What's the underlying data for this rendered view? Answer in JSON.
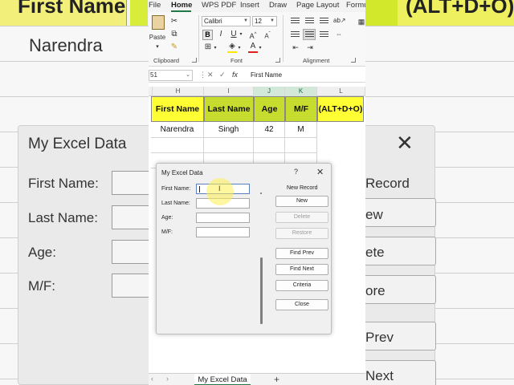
{
  "background": {
    "header_text": "First Name",
    "right_header_text": "(ALT+D+O)",
    "name_text": "Narendra",
    "panel": {
      "title": "My Excel Data",
      "labels": [
        "First Name:",
        "Last Name:",
        "Age:",
        "M/F:"
      ],
      "right_text": [
        "Record",
        "ew",
        "ete",
        "ore",
        "Prev",
        "Next"
      ]
    }
  },
  "menu": {
    "tabs": [
      "File",
      "Home",
      "WPS PDF",
      "Insert",
      "Draw",
      "Page Layout",
      "Formu"
    ],
    "active": "Home"
  },
  "ribbon": {
    "clipboard": {
      "paste_label": "Paste",
      "group_label": "Clipboard"
    },
    "font": {
      "font_name": "Calibri",
      "font_size": "12",
      "group_label": "Font",
      "bold": "B",
      "italic": "I",
      "underline": "U"
    },
    "alignment": {
      "group_label": "Alignment"
    }
  },
  "formula_bar": {
    "name_box": "51",
    "fx": "fx",
    "content": "First Name"
  },
  "columns": [
    "H",
    "I",
    "J",
    "K",
    "L"
  ],
  "sheet": {
    "headers": [
      "First Name",
      "Last Name",
      "Age",
      "M/F",
      "(ALT+D+O)"
    ],
    "row1": [
      "Narendra",
      "Singh",
      "42",
      "M"
    ]
  },
  "sheet_tabs": {
    "active": "My Excel Data",
    "add": "+"
  },
  "dialog": {
    "title": "My Excel Data",
    "help": "?",
    "close": "✕",
    "fields": [
      {
        "label": "First Name:",
        "value": ""
      },
      {
        "label": "Last Name:",
        "value": ""
      },
      {
        "label": "Age:",
        "value": ""
      },
      {
        "label": "M/F:",
        "value": ""
      }
    ],
    "record_status": "New Record",
    "buttons": [
      {
        "label": "New",
        "enabled": true
      },
      {
        "label": "Delete",
        "enabled": false
      },
      {
        "label": "Restore",
        "enabled": false
      },
      {
        "label": "Find Prev",
        "enabled": true
      },
      {
        "label": "Find Next",
        "enabled": true
      },
      {
        "label": "Criteria",
        "enabled": true
      },
      {
        "label": "Close",
        "enabled": true
      }
    ]
  },
  "colors": {
    "header_yellow": "#ffff33",
    "header_green": "#c6dc2e",
    "excel_green": "#1f7a47"
  }
}
